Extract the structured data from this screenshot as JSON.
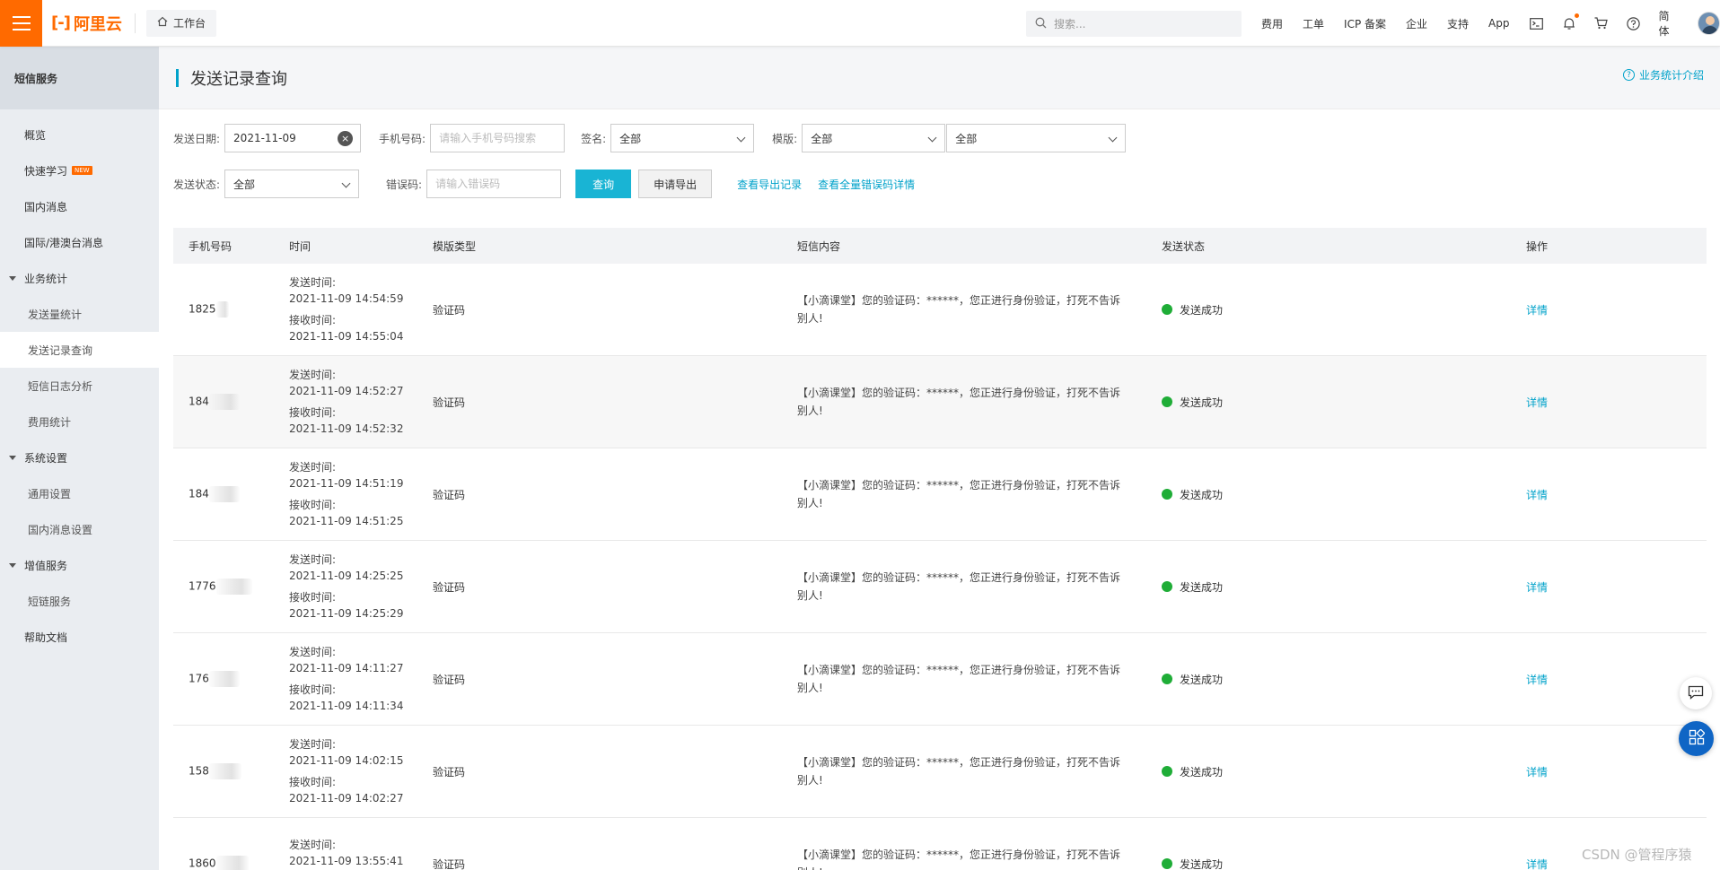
{
  "topbar": {
    "logo_mark": "[-]",
    "logo_text": "阿里云",
    "workbench": "工作台",
    "search_placeholder": "搜索...",
    "links": [
      "费用",
      "工单",
      "ICP 备案",
      "企业",
      "支持",
      "App"
    ],
    "lang": "简体",
    "notification_dot_color": "#ff6a00"
  },
  "sidebar": {
    "title": "短信服务",
    "items": [
      {
        "label": "概览"
      },
      {
        "label": "快速学习",
        "badge": "NEW"
      },
      {
        "label": "国内消息"
      },
      {
        "label": "国际/港澳台消息"
      },
      {
        "label": "业务统计"
      },
      {
        "label": "发送量统计"
      },
      {
        "label": "发送记录查询"
      },
      {
        "label": "短信日志分析"
      },
      {
        "label": "费用统计"
      },
      {
        "label": "系统设置"
      },
      {
        "label": "通用设置"
      },
      {
        "label": "国内消息设置"
      },
      {
        "label": "增值服务"
      },
      {
        "label": "短链服务"
      },
      {
        "label": "帮助文档"
      }
    ]
  },
  "page": {
    "title": "发送记录查询",
    "help_link": "业务统计介绍"
  },
  "filters": {
    "date_label": "发送日期:",
    "date_value": "2021-11-09",
    "phone_label": "手机号码:",
    "phone_placeholder": "请输入手机号码搜索",
    "sign_label": "签名:",
    "sign_value": "全部",
    "template_label": "模版:",
    "template_value_1": "全部",
    "template_value_2": "全部",
    "status_label": "发送状态:",
    "status_value": "全部",
    "error_label": "错误码:",
    "error_placeholder": "请输入错误码",
    "query_button": "查询",
    "export_button": "申请导出",
    "export_records_link": "查看导出记录",
    "error_details_link": "查看全量错误码详情"
  },
  "table": {
    "headers": [
      "手机号码",
      "时间",
      "模版类型",
      "短信内容",
      "发送状态",
      "操作"
    ],
    "send_time_label": "发送时间:",
    "receive_time_label": "接收时间:",
    "rows": [
      {
        "phone": "1825",
        "send_time": "2021-11-09 14:54:59",
        "receive_time": "2021-11-09 14:55:04",
        "type": "验证码",
        "content": "【小滴课堂】您的验证码：******，您正进行身份验证，打死不告诉别人!",
        "status": "发送成功",
        "action": "详情"
      },
      {
        "phone": "184",
        "send_time": "2021-11-09 14:52:27",
        "receive_time": "2021-11-09 14:52:32",
        "type": "验证码",
        "content": "【小滴课堂】您的验证码：******，您正进行身份验证，打死不告诉别人!",
        "status": "发送成功",
        "action": "详情"
      },
      {
        "phone": "184",
        "send_time": "2021-11-09 14:51:19",
        "receive_time": "2021-11-09 14:51:25",
        "type": "验证码",
        "content": "【小滴课堂】您的验证码：******，您正进行身份验证，打死不告诉别人!",
        "status": "发送成功",
        "action": "详情"
      },
      {
        "phone": "1776",
        "send_time": "2021-11-09 14:25:25",
        "receive_time": "2021-11-09 14:25:29",
        "type": "验证码",
        "content": "【小滴课堂】您的验证码：******，您正进行身份验证，打死不告诉别人!",
        "status": "发送成功",
        "action": "详情"
      },
      {
        "phone": "176",
        "send_time": "2021-11-09 14:11:27",
        "receive_time": "2021-11-09 14:11:34",
        "type": "验证码",
        "content": "【小滴课堂】您的验证码：******，您正进行身份验证，打死不告诉别人!",
        "status": "发送成功",
        "action": "详情"
      },
      {
        "phone": "158",
        "send_time": "2021-11-09 14:02:15",
        "receive_time": "2021-11-09 14:02:27",
        "type": "验证码",
        "content": "【小滴课堂】您的验证码：******，您正进行身份验证，打死不告诉别人!",
        "status": "发送成功",
        "action": "详情"
      },
      {
        "phone": "1860",
        "send_time": "2021-11-09 13:55:41",
        "receive_time": "",
        "type": "验证码",
        "content": "【小滴课堂】您的验证码：******，您正进行身份验证，打死不告诉别人!",
        "status": "发送成功",
        "action": "详情"
      }
    ]
  },
  "watermark": "CSDN @管程序猿",
  "colors": {
    "accent": "#ff6a00",
    "link": "#00a2ca",
    "primary_button": "#19b4d4",
    "success": "#1fad37"
  }
}
